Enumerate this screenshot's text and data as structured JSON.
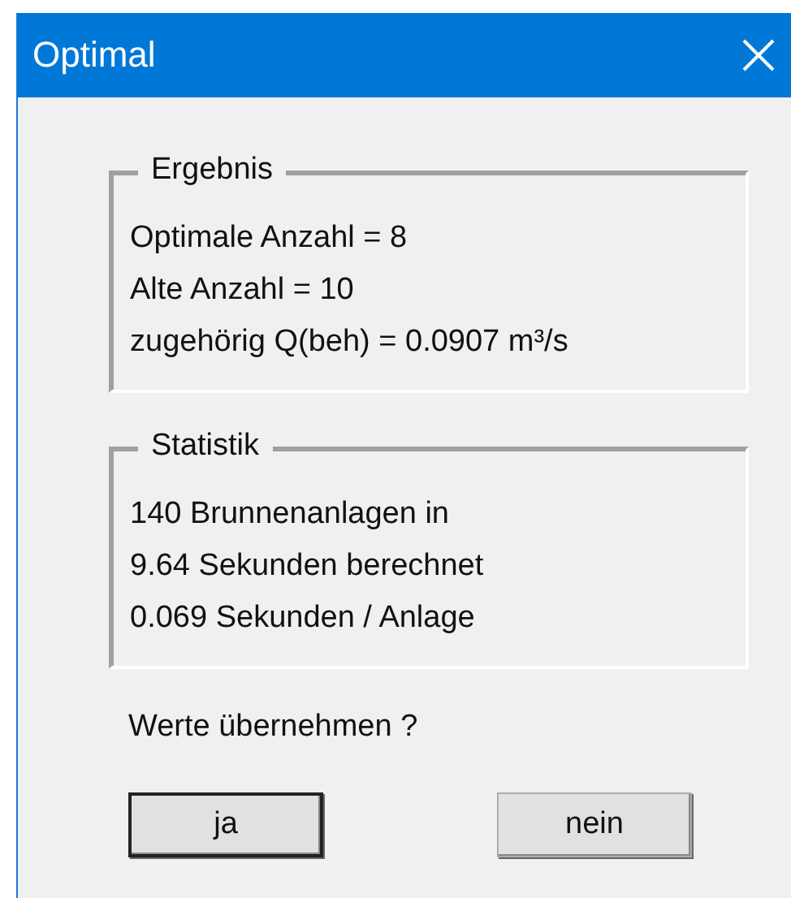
{
  "window": {
    "title": "Optimal"
  },
  "groups": [
    {
      "title": "Ergebnis",
      "lines": [
        "Optimale Anzahl = 8",
        "Alte Anzahl = 10",
        "zugehörig Q(beh) = 0.0907 m³/s"
      ]
    },
    {
      "title": "Statistik",
      "lines": [
        "140 Brunnenanlagen in",
        "9.64 Sekunden berechnet",
        "0.069 Sekunden / Anlage"
      ]
    }
  ],
  "question": "Werte übernehmen ?",
  "buttons": [
    {
      "label": "ja",
      "default": true
    },
    {
      "label": "nein",
      "default": false
    }
  ]
}
